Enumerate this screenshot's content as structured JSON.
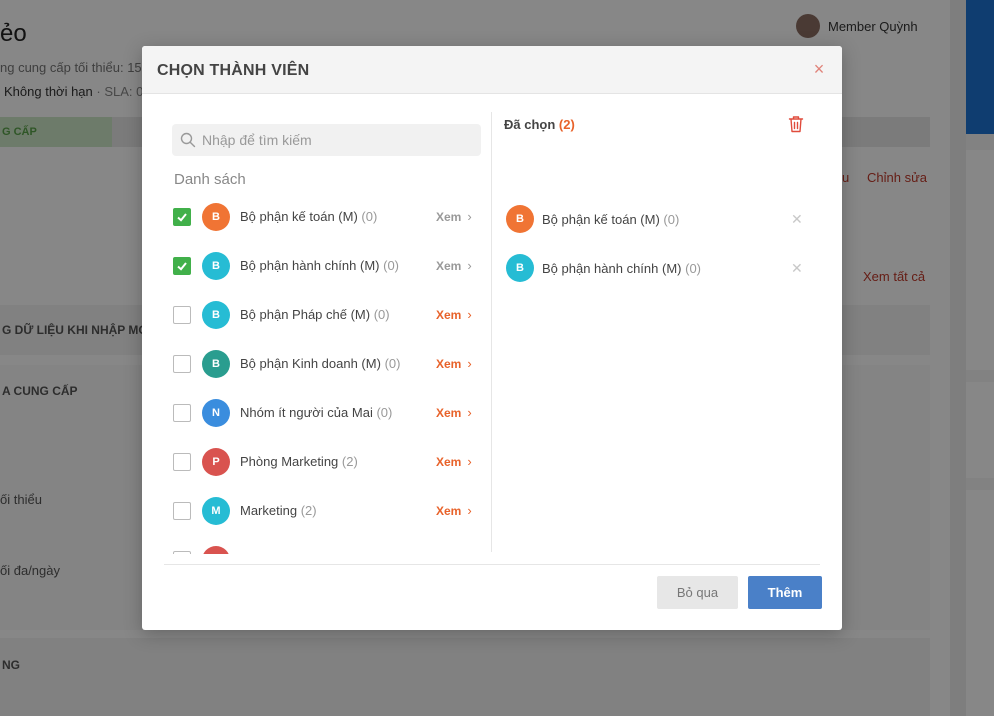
{
  "background": {
    "page_title": "ẻo",
    "meta_line_1": "ng cung cấp tối thiểu: 15",
    "meta_line_2_main": "Không thời hạn",
    "meta_line_2_sep": " · SLA: 0n",
    "stage_active": "G CẤP",
    "user_name": "Member Quỳnh",
    "link_edit": "Chỉnh sửa",
    "link_partial": "u",
    "link_view_all": "Xem tất cả",
    "section_1": "G DỮ LIỆU KHI NHẬP MỚI",
    "section_2": "A CUNG CẤP",
    "label_1": "ối thiểu",
    "label_2": "ối đa/ngày",
    "section_3": "NG"
  },
  "modal": {
    "title": "CHỌN THÀNH VIÊN",
    "close_icon": "close-icon",
    "search": {
      "placeholder": "Nhập để tìm kiếm"
    },
    "list_heading": "Danh sách",
    "view_label": "Xem",
    "items": [
      {
        "initial": "B",
        "name": "Bộ phận kế toán (M)",
        "count": "(0)",
        "checked": true,
        "color": "#f07434",
        "view_style": "grey"
      },
      {
        "initial": "B",
        "name": "Bộ phận hành chính (M)",
        "count": "(0)",
        "checked": true,
        "color": "#26bcd4",
        "view_style": "grey"
      },
      {
        "initial": "B",
        "name": "Bộ phận Pháp chế (M)",
        "count": "(0)",
        "checked": false,
        "color": "#26bcd4",
        "view_style": "orange"
      },
      {
        "initial": "B",
        "name": "Bộ phận Kinh doanh (M)",
        "count": "(0)",
        "checked": false,
        "color": "#2a9d8f",
        "view_style": "orange"
      },
      {
        "initial": "N",
        "name": "Nhóm ít người của Mai",
        "count": "(0)",
        "checked": false,
        "color": "#3a8dde",
        "view_style": "orange"
      },
      {
        "initial": "P",
        "name": "Phòng Marketing",
        "count": "(2)",
        "checked": false,
        "color": "#d9534f",
        "view_style": "orange"
      },
      {
        "initial": "M",
        "name": "Marketing",
        "count": "(2)",
        "checked": false,
        "color": "#26bcd4",
        "view_style": "orange"
      }
    ],
    "selected_heading": "Đã chọn",
    "selected_count": "(2)",
    "selected": [
      {
        "initial": "B",
        "name": "Bộ phận kế toán (M)",
        "count": "(0)",
        "color": "#f07434"
      },
      {
        "initial": "B",
        "name": "Bộ phận hành chính (M)",
        "count": "(0)",
        "color": "#26bcd4"
      }
    ],
    "buttons": {
      "skip": "Bỏ qua",
      "add": "Thêm"
    }
  }
}
